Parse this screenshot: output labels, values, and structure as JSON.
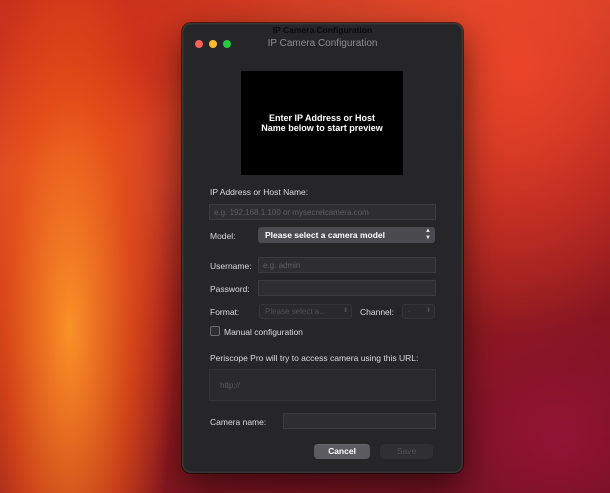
{
  "window": {
    "ghost_title": "IP Camera Configuration",
    "title": "IP Camera Configuration"
  },
  "preview": {
    "message": "Enter IP Address or Host\nName below to start preview"
  },
  "form": {
    "address_label": "IP Address or Host Name:",
    "address_placeholder": "e.g. 192.168.1.100 or mysecretcamera.com",
    "model_label": "Model:",
    "model_value": "Please select a camera model",
    "username_label": "Username:",
    "username_placeholder": "e.g. admin",
    "password_label": "Password:",
    "format_label": "Format:",
    "format_value": "Please select a...",
    "channel_label": "Channel:",
    "channel_value": "-",
    "manual_label": "Manual configuration",
    "url_caption": "Periscope Pro will try to access camera using this URL:",
    "url_placeholder": "http://",
    "camera_name_label": "Camera name:"
  },
  "buttons": {
    "cancel": "Cancel",
    "save": "Save"
  }
}
